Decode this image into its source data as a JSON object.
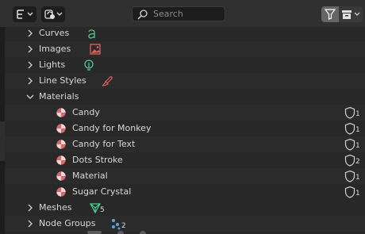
{
  "search": {
    "placeholder": "Search"
  },
  "tree": {
    "categories_top": [
      {
        "label": "Curves",
        "icon": "curve-icon"
      },
      {
        "label": "Images",
        "icon": "image-icon"
      },
      {
        "label": "Lights",
        "icon": "light-icon"
      },
      {
        "label": "Line Styles",
        "icon": "linestyle-icon"
      }
    ],
    "materials": {
      "label": "Materials",
      "expanded": true,
      "items": [
        {
          "label": "Candy",
          "users": "1"
        },
        {
          "label": "Candy for Monkey",
          "users": "1"
        },
        {
          "label": "Candy for Text",
          "users": "1"
        },
        {
          "label": "Dots Stroke",
          "users": "2"
        },
        {
          "label": "Material",
          "users": "1"
        },
        {
          "label": "Sugar Crystal",
          "users": "1"
        }
      ]
    },
    "meshes": {
      "label": "Meshes",
      "count": "5"
    },
    "node_groups": {
      "label": "Node Groups",
      "count": "2"
    }
  },
  "colors": {
    "background": "#282828",
    "header": "#303030",
    "curve_icon": "#4ecb8d",
    "image_icon": "#e06060",
    "material_icon": "#d56a6a"
  }
}
